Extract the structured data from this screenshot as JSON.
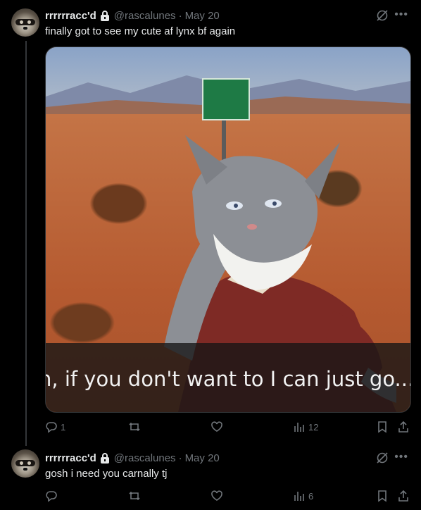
{
  "tweets": [
    {
      "name": "rrrrrracc'd",
      "handle": "@rascalunes",
      "separator": "·",
      "date": "May 20",
      "text": "finally got to see my cute af lynx bf again",
      "media": {
        "subtitle": "n, if you don't want to I can just go..."
      },
      "stats": {
        "replies": "1",
        "retweets": "",
        "likes": "",
        "views": "12"
      }
    },
    {
      "name": "rrrrrracc'd",
      "handle": "@rascalunes",
      "separator": "·",
      "date": "May 20",
      "text": "gosh i need you carnally tj",
      "stats": {
        "replies": "",
        "retweets": "",
        "likes": "",
        "views": "6"
      }
    }
  ],
  "icons": [
    "lock-icon",
    "grok-icon",
    "more-icon",
    "reply-icon",
    "retweet-icon",
    "like-icon",
    "views-icon",
    "bookmark-icon",
    "share-icon"
  ],
  "colors": {
    "background": "#000000",
    "text": "#e7e9ea",
    "muted": "#71767b"
  }
}
